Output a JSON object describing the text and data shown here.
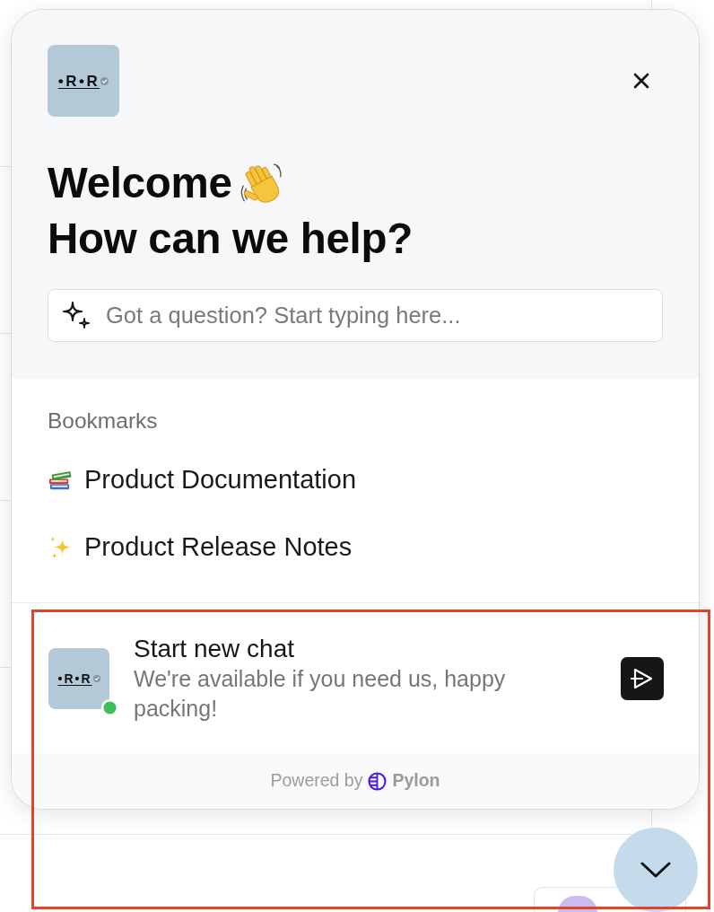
{
  "widget": {
    "header": {
      "logo": {
        "text": "•R•R"
      },
      "greeting": "Welcome",
      "title": "How can we help?",
      "search": {
        "placeholder": "Got a question? Start typing here..."
      }
    },
    "bookmarks": {
      "title": "Bookmarks",
      "items": [
        {
          "label": "Product Documentation"
        },
        {
          "label": "Product Release Notes"
        }
      ]
    },
    "new_chat": {
      "avatar": {
        "text": "•R•R"
      },
      "online": true,
      "title": "Start new chat",
      "subtitle": "We're available if you need us, happy packing!"
    },
    "footer": {
      "prefix": "Powered by",
      "brand": "Pylon"
    }
  }
}
